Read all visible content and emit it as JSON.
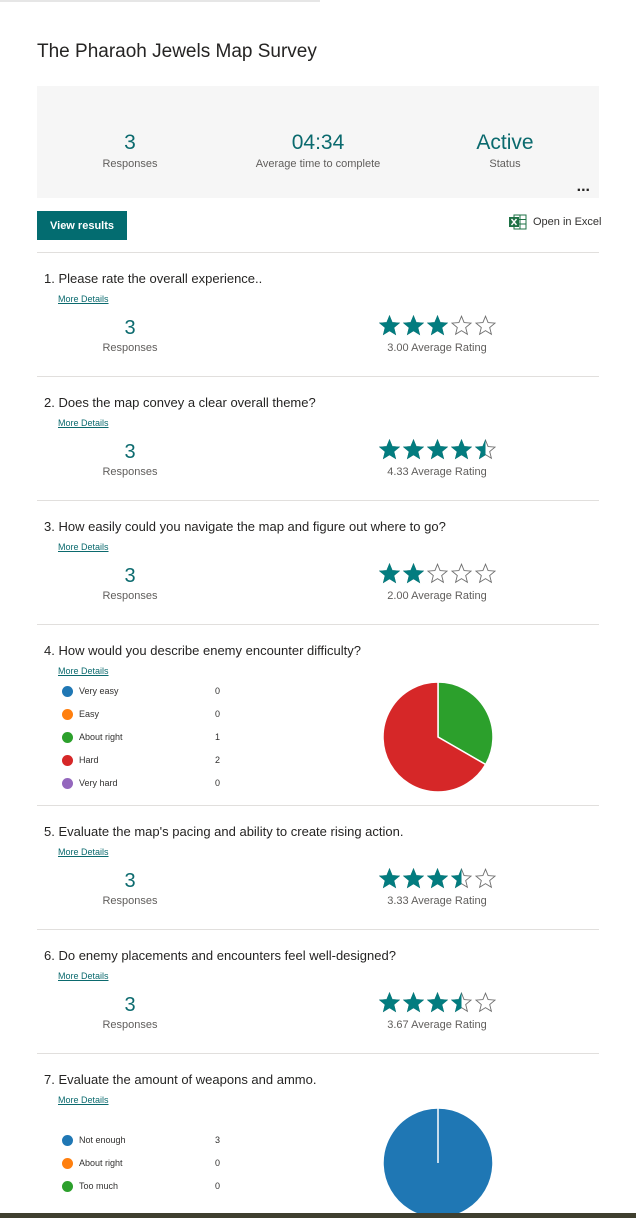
{
  "survey": {
    "title": "The Pharaoh Jewels Map Survey",
    "stats": [
      {
        "value": "3",
        "label": "Responses"
      },
      {
        "value": "04:34",
        "label": "Average time to complete"
      },
      {
        "value": "Active",
        "label": "Status"
      }
    ],
    "more_icon": "ellipsis-icon",
    "more_text": "...",
    "view_results_label": "View results",
    "open_excel_label": "Open in Excel",
    "excel_icon": "excel-icon"
  },
  "colors": {
    "accent": "#036c70",
    "teal_text": "#0b6a6e",
    "star": "#037c7f",
    "blue": "#1f77b4",
    "orange": "#ff7f0e",
    "green": "#2ca02c",
    "red": "#d62728",
    "purple": "#9467bd"
  },
  "questions": [
    {
      "number": "1.",
      "title": "Please rate the overall experience..",
      "more_details": "More Details",
      "responses": "3",
      "responses_label": "Responses",
      "rating": 3.0,
      "rating_label": "3.00 Average Rating"
    },
    {
      "number": "2.",
      "title": "Does the map convey a clear overall theme?",
      "more_details": "More Details",
      "responses": "3",
      "responses_label": "Responses",
      "rating": 4.33,
      "rating_label": "4.33 Average Rating"
    },
    {
      "number": "3.",
      "title": "How easily could you navigate the map and figure out where to go?",
      "more_details": "More Details",
      "responses": "3",
      "responses_label": "Responses",
      "rating": 2.0,
      "rating_label": "2.00 Average Rating"
    },
    {
      "number": "4.",
      "title": "How would you describe enemy encounter difficulty?",
      "more_details": "More Details",
      "options": [
        {
          "label": "Very easy",
          "count": 0,
          "color": "#1f77b4"
        },
        {
          "label": "Easy",
          "count": 0,
          "color": "#ff7f0e"
        },
        {
          "label": "About right",
          "count": 1,
          "color": "#2ca02c"
        },
        {
          "label": "Hard",
          "count": 2,
          "color": "#d62728"
        },
        {
          "label": "Very hard",
          "count": 0,
          "color": "#9467bd"
        }
      ]
    },
    {
      "number": "5.",
      "title": "Evaluate the map's pacing and ability to create rising action.",
      "more_details": "More Details",
      "responses": "3",
      "responses_label": "Responses",
      "rating": 3.33,
      "rating_label": "3.33 Average Rating"
    },
    {
      "number": "6.",
      "title": "Do enemy placements and encounters feel well-designed?",
      "more_details": "More Details",
      "responses": "3",
      "responses_label": "Responses",
      "rating": 3.67,
      "rating_label": "3.67 Average Rating"
    },
    {
      "number": "7.",
      "title": "Evaluate the amount of weapons and ammo.",
      "more_details": "More Details",
      "options": [
        {
          "label": "Not enough",
          "count": 3,
          "color": "#1f77b4"
        },
        {
          "label": "About right",
          "count": 0,
          "color": "#ff7f0e"
        },
        {
          "label": "Too much",
          "count": 0,
          "color": "#2ca02c"
        }
      ]
    }
  ]
}
